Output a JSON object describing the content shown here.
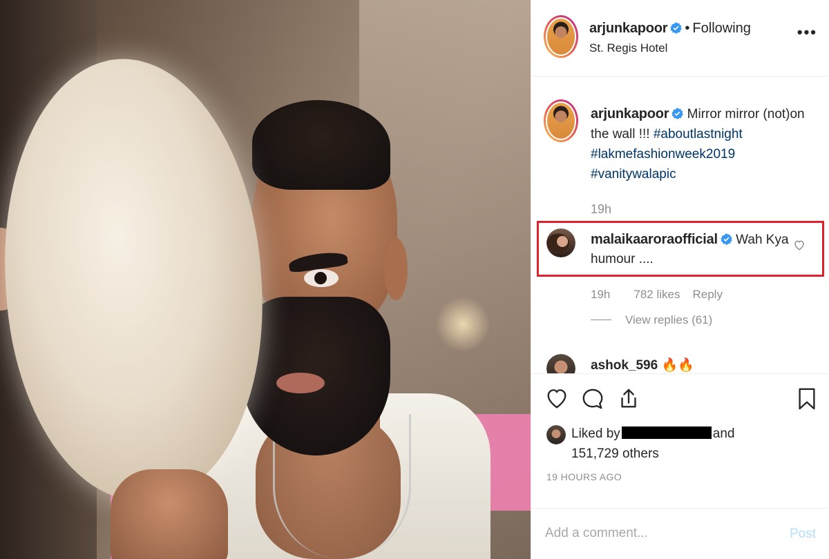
{
  "post": {
    "author": "arjunkapoor",
    "follow_status": "Following",
    "separator": "•",
    "location": "St. Regis Hotel",
    "more_label": "•••"
  },
  "caption": {
    "author": "arjunkapoor",
    "text": "Mirror mirror (not)on the wall !!!",
    "hashtags": [
      "#aboutlastnight",
      "#lakmefashionweek2019",
      "#vanitywalapic"
    ],
    "time": "19h"
  },
  "highlighted_comment": {
    "author": "malaikaaroraofficial",
    "text": "Wah Kya humour ....",
    "time": "19h",
    "likes": "782 likes",
    "reply_label": "Reply",
    "view_replies": "View replies (61)"
  },
  "next_comment": {
    "author": "ashok_596",
    "text": "🔥🔥"
  },
  "engagement": {
    "liked_by_prefix": "Liked by",
    "liked_by_suffix": "and",
    "others": "151,729 others",
    "timestamp": "19 HOURS AGO"
  },
  "comment_box": {
    "placeholder": "Add a comment...",
    "post_label": "Post"
  },
  "colors": {
    "highlight_border": "#e0202a",
    "verified_badge": "#3897f0",
    "hashtag": "#003569",
    "muted_text": "#8e8e8e"
  },
  "icons": {
    "like": "heart-icon",
    "comment": "comment-bubble-icon",
    "share": "share-icon",
    "save": "bookmark-icon",
    "verified": "verified-badge-icon",
    "more": "more-options-icon"
  }
}
